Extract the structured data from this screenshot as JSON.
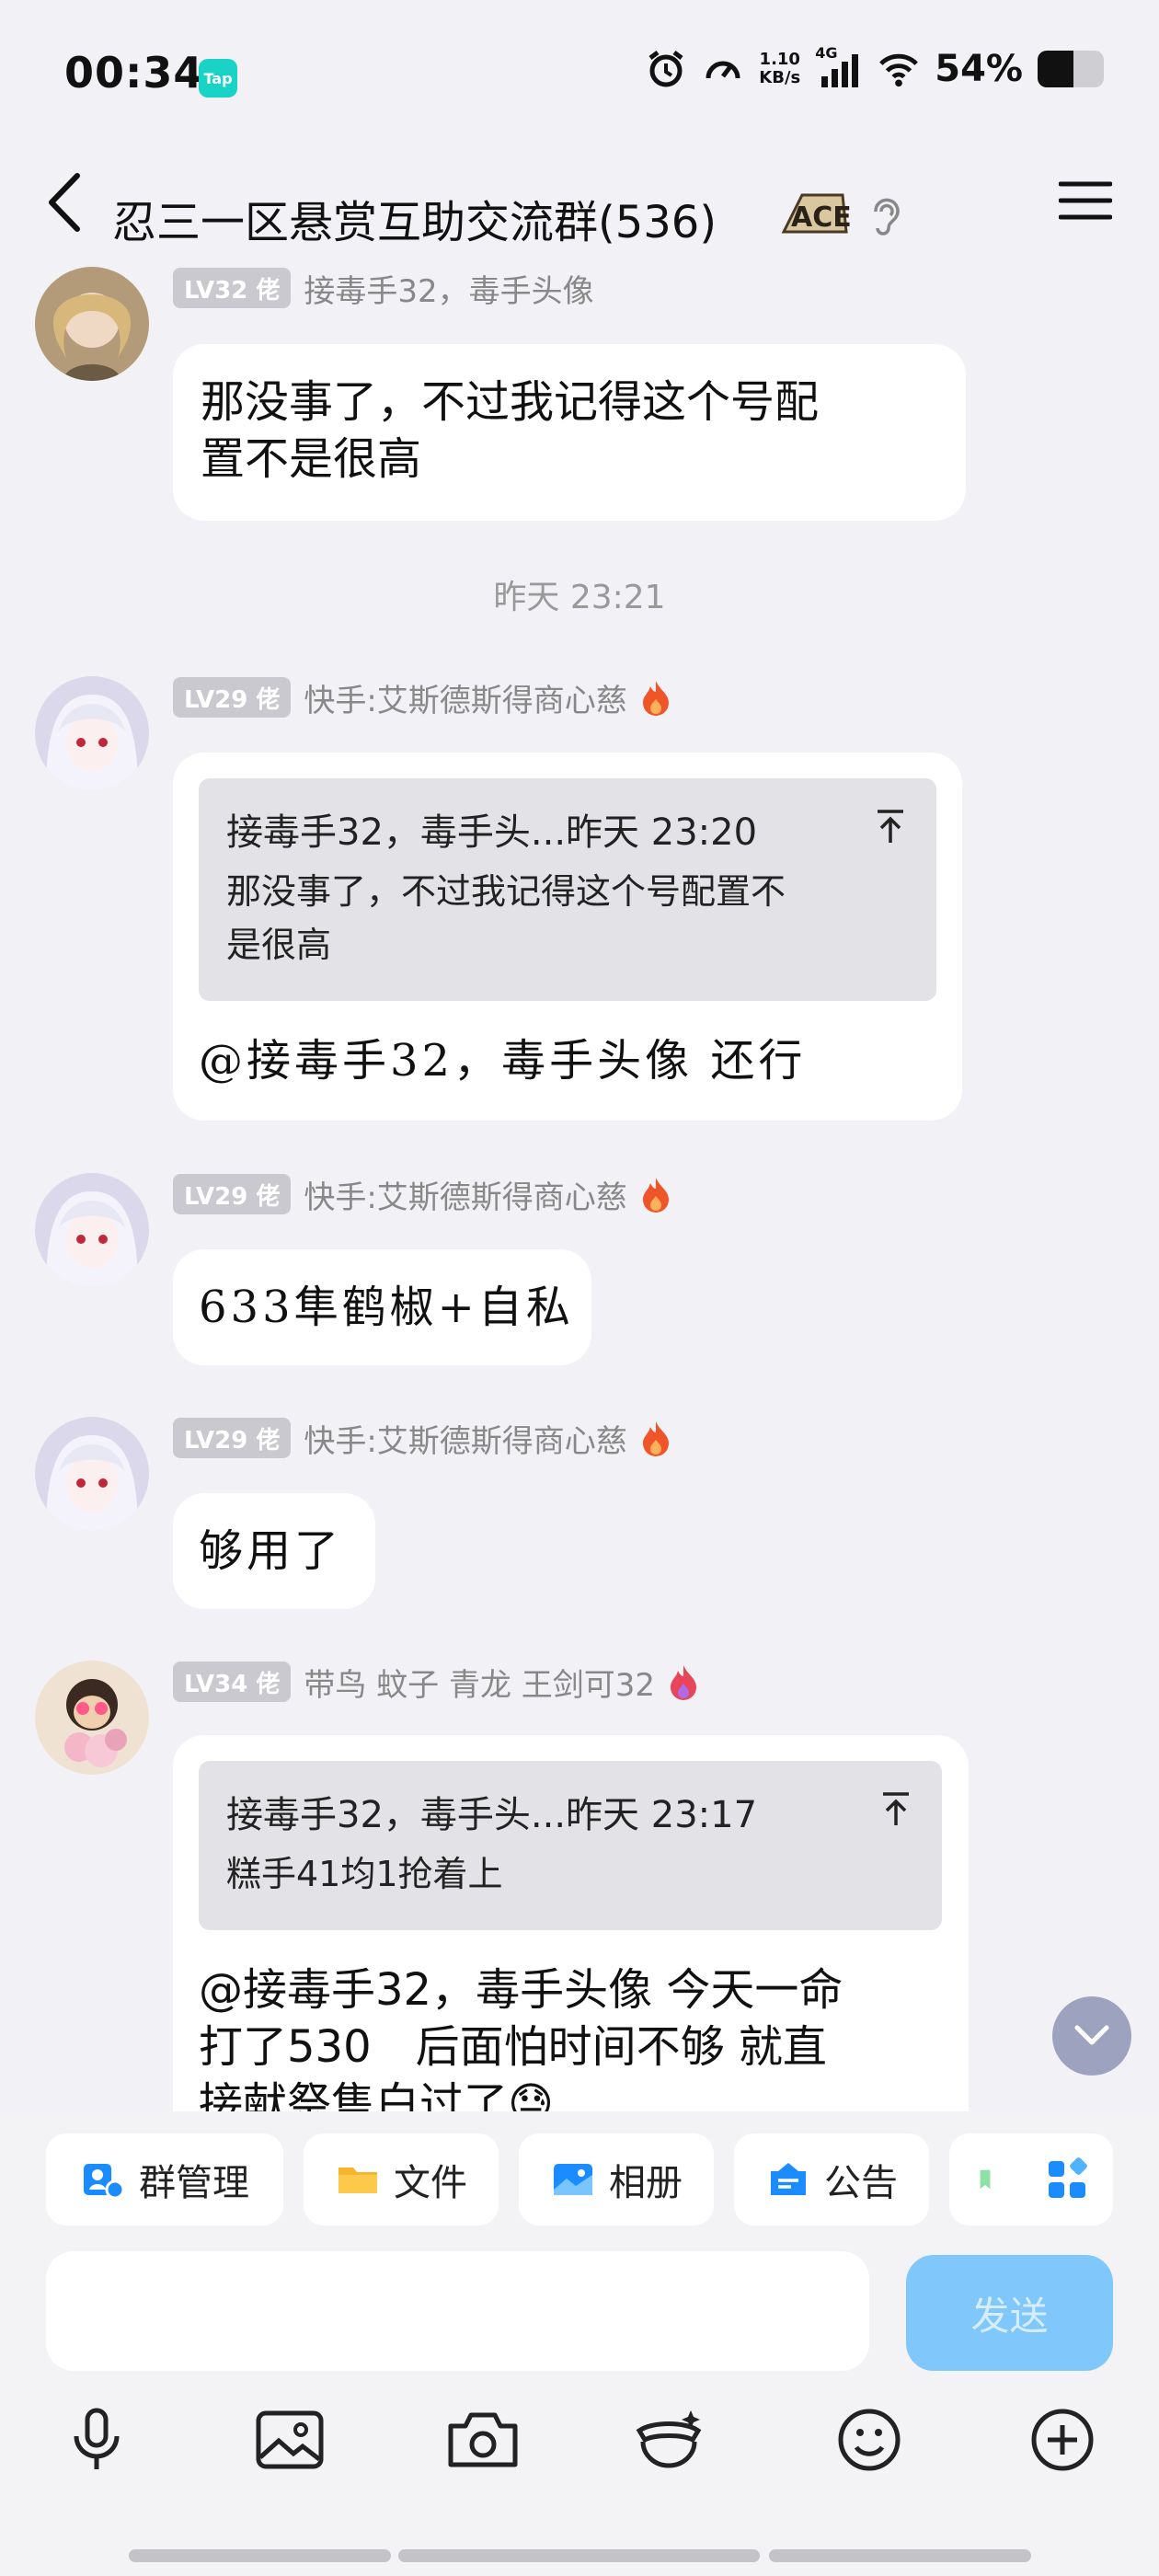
{
  "status_bar": {
    "time": "00:34",
    "tap_badge": "Tap",
    "net_speed_value": "1.10",
    "net_speed_unit": "KB/s",
    "network": "4G",
    "battery_text": "54%",
    "battery_level": 0.54,
    "icons": [
      "alarm-icon",
      "speedometer-icon",
      "signal-icon",
      "wifi-icon",
      "battery-icon"
    ]
  },
  "header": {
    "title": "忍三一区悬赏互助交流群(536)",
    "badge": "ACE",
    "icons": [
      "back-arrow-icon",
      "ear-icon",
      "menu-icon"
    ]
  },
  "chat": {
    "messages": [
      {
        "level": "LV32 佬",
        "sender": "接毒手32，毒手头像",
        "text": "那没事了，不过我记得这个号配置不是很高",
        "lines": [
          "那没事了，不过我记得这个号配",
          "置不是很高"
        ]
      },
      {
        "timestamp": "昨天 23:21"
      },
      {
        "level": "LV29 佬",
        "sender": "快手:艾斯德斯得商心慈",
        "quote_head": "接毒手32，毒手头...昨天 23:20",
        "quote_lines": [
          "那没事了，不过我记得这个号配置不",
          "是很高"
        ],
        "text": "@接毒手32，毒手头像 还行"
      },
      {
        "level": "LV29 佬",
        "sender": "快手:艾斯德斯得商心慈",
        "text": "633隼鹤椒+自私"
      },
      {
        "level": "LV29 佬",
        "sender": "快手:艾斯德斯得商心慈",
        "text": "够用了"
      },
      {
        "level": "LV34 佬",
        "sender": "带鸟 蚊子  青龙  王剑可32",
        "quote_head": "接毒手32，毒手头...昨天 23:17",
        "quote_lines": [
          "糕手41均1抢着上"
        ],
        "lines": [
          "@接毒手32，毒手头像 今天一命",
          "打了530　后面怕时间不够  就直",
          "接献祭售白过了"
        ]
      }
    ]
  },
  "toolbar": {
    "items": [
      {
        "label": "群管理",
        "icon": "group-manage-icon"
      },
      {
        "label": "文件",
        "icon": "folder-icon"
      },
      {
        "label": "相册",
        "icon": "album-icon"
      },
      {
        "label": "公告",
        "icon": "announcement-icon"
      }
    ],
    "more_icon": "apps-grid-icon"
  },
  "input": {
    "placeholder": "",
    "send_label": "发送"
  },
  "actions": [
    "microphone-icon",
    "image-icon",
    "camera-icon",
    "magic-face-icon",
    "emoji-icon",
    "plus-icon"
  ],
  "colors": {
    "background": "#f2f2f6",
    "bubble": "#ffffff",
    "level_badge": "#c9c9cf",
    "send_button": "#80c7fb",
    "quote_bg": "#e3e3e7"
  }
}
